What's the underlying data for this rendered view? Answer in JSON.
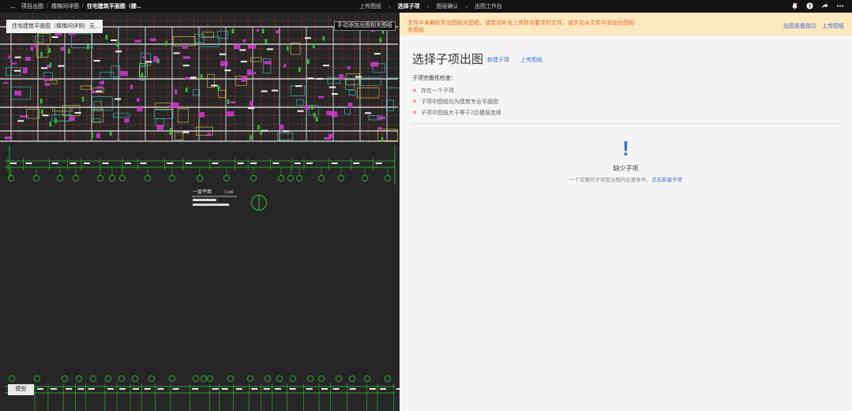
{
  "breadcrumb": {
    "back_icon": "arrow-left-icon",
    "items": [
      "项目出图",
      "楼梯间详图",
      "住宅建筑平面图（楼..."
    ]
  },
  "steps": [
    "上传图纸",
    "选择子项",
    "图层确认",
    "出图工作台"
  ],
  "active_step": "选择子项",
  "toolbar_icons": [
    "bell-icon",
    "help-icon",
    "share-icon",
    "more-icon"
  ],
  "viewer": {
    "file_tag": "住宅建筑平面图（楼梯间详例）无...",
    "manual_button": "手动添加出图相关图纸",
    "model_tab": "模型",
    "plan_label": "一层平面",
    "plan_scale": "1:100"
  },
  "banner": {
    "message": "文件中未解析到出图相关图纸，请尝试补充上传符合要求的文件，或手动从文件中添加出图相关图纸",
    "link1": "出图准备指引",
    "link2": "上传图纸"
  },
  "panel": {
    "title": "选择子项出图",
    "new_subitem": "新建子项",
    "upload": "上传图纸",
    "check_title": "子项完备性检查：",
    "checks": [
      "存在一个子项",
      "子项中图纸均为建筑专业平面图",
      "子项中图纸大于等于2且楼层连续"
    ]
  },
  "empty": {
    "icon": "exclamation-icon",
    "title": "缺少子项",
    "desc": "一个完整的子项是出图的必要条件，",
    "link": "点击新建子项"
  },
  "colors": {
    "accent": "#3d6bd1",
    "warning_bg": "#fde9bf",
    "warning_text": "#e0662a",
    "error": "#e23b3b"
  }
}
